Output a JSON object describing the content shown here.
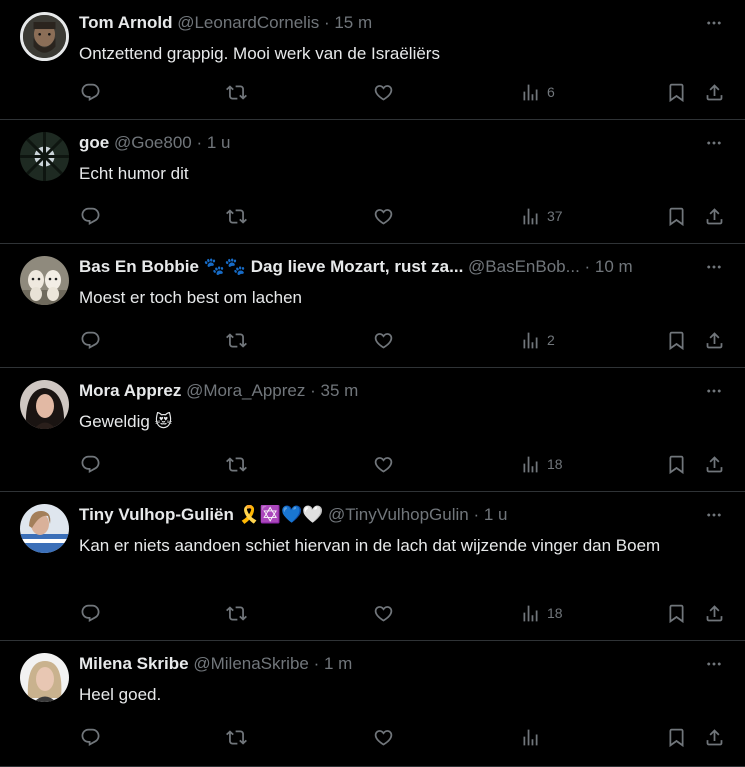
{
  "tweets": [
    {
      "name": "Tom Arnold",
      "handle": "@LeonardCornelis",
      "dot": " · ",
      "time": "15 m",
      "text": "Ontzettend grappig. Mooi werk van de Israëliërs",
      "views": "6",
      "avatar": "avatar-bearded-man"
    },
    {
      "name": "goe",
      "handle": "@Goe800",
      "dot": " · ",
      "time": "1 u",
      "text": "Echt humor dit",
      "views": "37",
      "avatar": "avatar-trees"
    },
    {
      "name": "Bas En Bobbie 🐾🐾 Dag lieve Mozart, rust za...",
      "handle": "@BasEnBob...",
      "dot": " · ",
      "time": "10 m",
      "text": "Moest er toch best om lachen",
      "views": "2",
      "avatar": "avatar-dogs"
    },
    {
      "name": "Mora Apprez",
      "handle": "@Mora_Apprez",
      "dot": " · ",
      "time": "35 m",
      "text": "Geweldig 😻",
      "views": "18",
      "avatar": "avatar-woman"
    },
    {
      "name": "Tiny Vulhop-Guliën 🎗️✡️💙🤍",
      "handle": "@TinyVulhopGulin",
      "dot": " · ",
      "time": "1 u",
      "text": "Kan er niets aandoen schiet hiervan in de lach dat wijzende vinger dan Boem",
      "views": "18",
      "avatar": "avatar-woman-flag"
    },
    {
      "name": "Milena Skribe",
      "handle": "@MilenaSkribe",
      "dot": " · ",
      "time": "1 m",
      "text": "Heel goed.",
      "views": "",
      "avatar": "avatar-blonde-woman"
    }
  ],
  "colors": {
    "background": "#000000",
    "text": "#e7e9ea",
    "muted": "#71767b",
    "divider": "#2f3336"
  }
}
